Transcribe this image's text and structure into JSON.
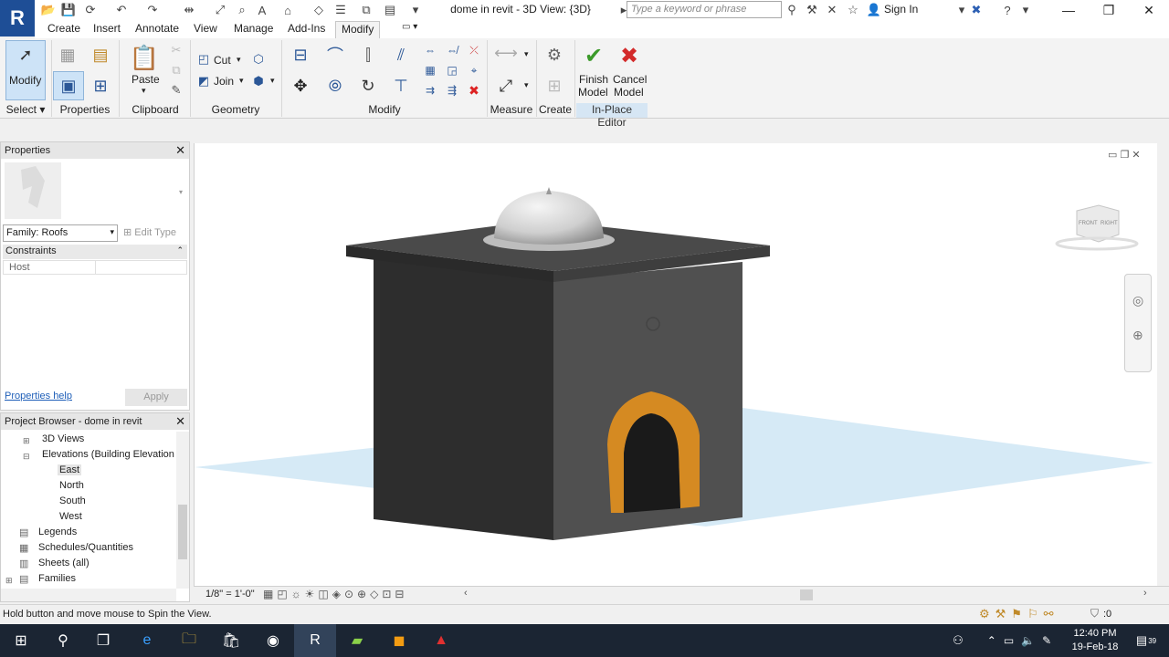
{
  "titlebar": {
    "app_letter": "R",
    "doc_title": "dome in revit - 3D View: {3D}",
    "search_placeholder": "Type a keyword or phrase",
    "signin": "Sign In"
  },
  "tabs": [
    "Create",
    "Insert",
    "Annotate",
    "View",
    "Manage",
    "Add-Ins",
    "Modify"
  ],
  "ribbon": {
    "modify_label": "Modify",
    "paste_label": "Paste",
    "cut_label": "Cut",
    "join_label": "Join",
    "finish_label_1": "Finish",
    "finish_label_2": "Model",
    "cancel_label_1": "Cancel",
    "cancel_label_2": "Model",
    "panels": {
      "select": "Select",
      "properties": "Properties",
      "clipboard": "Clipboard",
      "geometry": "Geometry",
      "modify": "Modify",
      "measure": "Measure",
      "create": "Create",
      "inplace": "In-Place Editor"
    }
  },
  "properties": {
    "title": "Properties",
    "family": "Family: Roofs",
    "edit_type": "Edit Type",
    "constraints": "Constraints",
    "host_label": "Host",
    "help_link": "Properties help",
    "apply": "Apply"
  },
  "browser": {
    "title": "Project Browser - dome in revit",
    "items": {
      "views3d": "3D Views",
      "elevations": "Elevations (Building Elevation",
      "east": "East",
      "north": "North",
      "south": "South",
      "west": "West",
      "legends": "Legends",
      "schedules": "Schedules/Quantities",
      "sheets": "Sheets (all)",
      "families": "Families"
    }
  },
  "view": {
    "scale": "1/8\" = 1'-0\"",
    "viewcube_front": "FRONT",
    "viewcube_right": "RIGHT"
  },
  "status": {
    "text": "Hold button and move mouse to Spin the View.",
    "filter_count": ":0"
  },
  "taskbar": {
    "time": "12:40 PM",
    "date": "19-Feb-18",
    "notif_count": "39"
  },
  "colors": {
    "app_blue": "#1e4e96",
    "ribbon_bg": "#f3f3f3",
    "selected_tool": "#cde3f7",
    "arch_orange": "#d58a22",
    "ground_blue": "#cfe6f4",
    "taskbar": "#1b2533"
  }
}
